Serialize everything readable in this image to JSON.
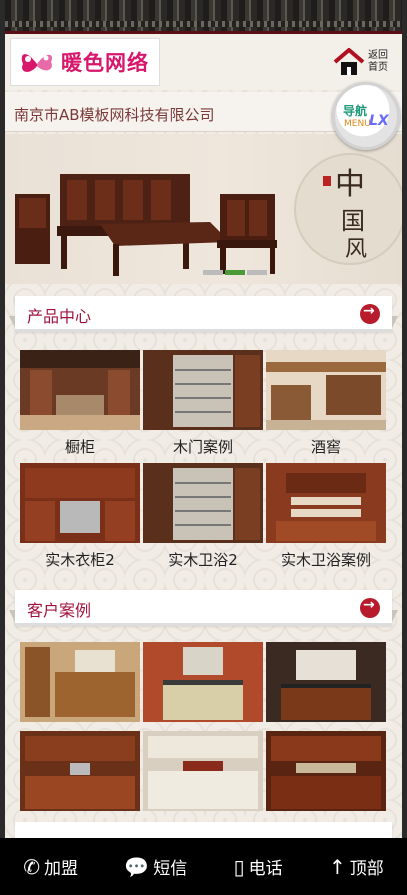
{
  "brand": {
    "logo_text": "暖色网络"
  },
  "header": {
    "home_label": "返回首页"
  },
  "company": {
    "name": "南京市AB模板网科技有限公司"
  },
  "menu": {
    "cn": "导航",
    "en": "MENU",
    "mark": "LX"
  },
  "sections": {
    "products": {
      "title": "产品中心",
      "items": [
        "橱柜",
        "木门案例",
        "酒窖",
        "实木衣柜2",
        "实木卫浴2",
        "实木卫浴案例"
      ]
    },
    "cases": {
      "title": "客户案例"
    }
  },
  "bottom_bar": {
    "items": [
      {
        "label": "加盟",
        "icon": "phone-icon"
      },
      {
        "label": "短信",
        "icon": "sms-icon"
      },
      {
        "label": "电话",
        "icon": "mobile-icon"
      },
      {
        "label": "顶部",
        "icon": "arrow-up-icon"
      }
    ]
  },
  "colors": {
    "accent": "#a0123c",
    "arrow": "#b81c2c",
    "company_text": "#7a3a3a",
    "logo": "#d8166b"
  }
}
